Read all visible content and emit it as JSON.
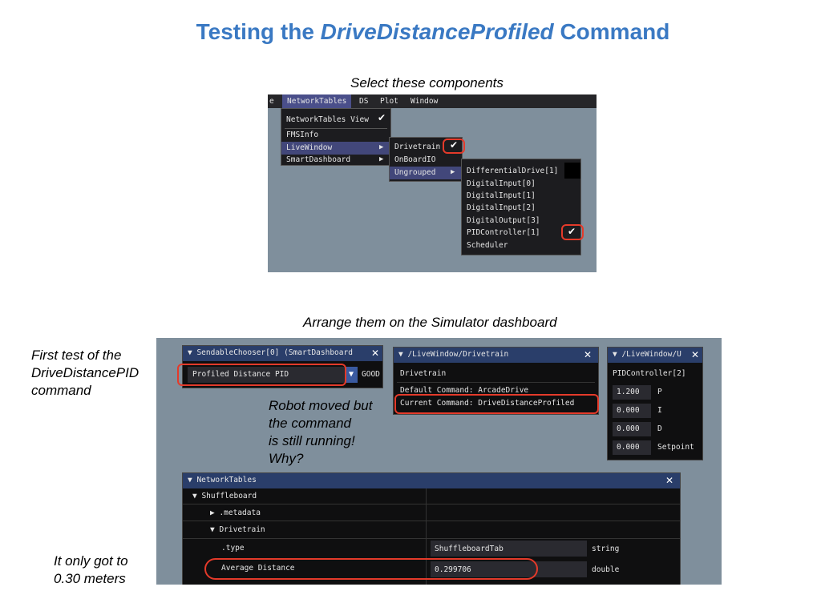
{
  "slide": {
    "title_pre": "Testing the ",
    "title_em": "DriveDistanceProfiled",
    "title_post": " Command",
    "caption_top": "Select these components",
    "caption_mid": "Arrange them on the Simulator dashboard",
    "note_left_1": "First test of the",
    "note_left_2": "DriveDistancePID",
    "note_left_3": "command",
    "note_bottom_1": "It only got to",
    "note_bottom_2": "0.30 meters",
    "note_robot_1": "Robot moved but",
    "note_robot_2": "the command",
    "note_robot_3": "is still running!",
    "note_robot_4": "Why?"
  },
  "menu": {
    "bar": [
      "e",
      "NetworkTables",
      "DS",
      "Plot",
      "Window"
    ],
    "nt_items": [
      "NetworkTables View",
      "FMSInfo",
      "LiveWindow",
      "SmartDashboard"
    ],
    "lw_items": [
      "Drivetrain",
      "OnBoardIO",
      "Ungrouped"
    ],
    "ug_items": [
      "DifferentialDrive[1]",
      "DigitalInput[0]",
      "DigitalInput[1]",
      "DigitalInput[2]",
      "DigitalOutput[3]",
      "PIDController[1]",
      "Scheduler"
    ]
  },
  "chooser": {
    "title": "SendableChooser[0] (SmartDashboard",
    "value": "Profiled Distance PID",
    "status": "GOOD"
  },
  "drivetrain": {
    "title": "/LiveWindow/Drivetrain",
    "name": "Drivetrain",
    "default_cmd": "Default Command: ArcadeDrive",
    "current_cmd": "Current Command: DriveDistanceProfiled"
  },
  "pid": {
    "title": "/LiveWindow/U",
    "name": "PIDController[2]",
    "rows": [
      {
        "value": "1.200",
        "label": "P"
      },
      {
        "value": "0.000",
        "label": "I"
      },
      {
        "value": "0.000",
        "label": "D"
      },
      {
        "value": "0.000",
        "label": "Setpoint"
      }
    ]
  },
  "nt": {
    "title": "NetworkTables",
    "shuffleboard": "Shuffleboard",
    "metadata": ".metadata",
    "drivetrain": "Drivetrain",
    "type_key": ".type",
    "type_value": "ShuffleboardTab",
    "type_kind": "string",
    "avg_key": "Average Distance",
    "avg_value": "0.299706",
    "avg_kind": "double"
  },
  "colors": {
    "title_blue": "#3a79c3",
    "highlight_red": "#e43a2a",
    "sim_bg": "#7f8f9c"
  }
}
